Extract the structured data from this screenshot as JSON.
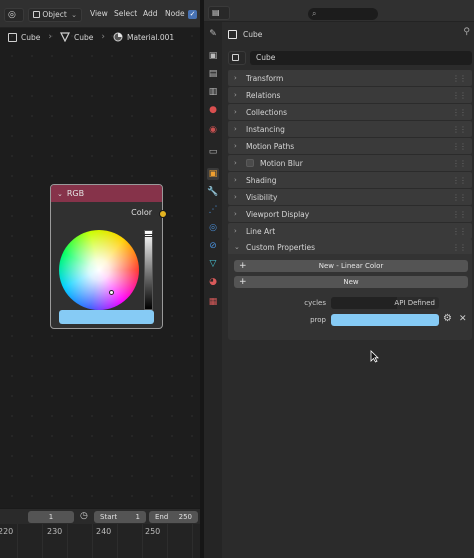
{
  "node_editor": {
    "header": {
      "mode": "Object",
      "menus": [
        "View",
        "Select",
        "Add",
        "Node"
      ]
    },
    "breadcrumb": [
      {
        "icon": "cube-icon",
        "label": "Cube"
      },
      {
        "icon": "mesh-data-icon",
        "label": "Cube"
      },
      {
        "icon": "material-icon",
        "label": "Material.001"
      }
    ],
    "node": {
      "title": "RGB",
      "output_label": "Color",
      "color": "#86cbf5",
      "header_color": "#86334a",
      "socket_color": "#e3b321"
    },
    "timeline": {
      "start_label": "Start",
      "start_value": "1",
      "end_label": "End",
      "end_value": "250",
      "current_frame": "1",
      "ruler_ticks": [
        "220",
        "230",
        "240",
        "250"
      ]
    }
  },
  "properties": {
    "object_name": "Cube",
    "object_field_value": "Cube",
    "panels": [
      {
        "label": "Transform",
        "expanded": false,
        "checkbox": false
      },
      {
        "label": "Relations",
        "expanded": false,
        "checkbox": false
      },
      {
        "label": "Collections",
        "expanded": false,
        "checkbox": false
      },
      {
        "label": "Instancing",
        "expanded": false,
        "checkbox": false
      },
      {
        "label": "Motion Paths",
        "expanded": false,
        "checkbox": false
      },
      {
        "label": "Motion Blur",
        "expanded": false,
        "checkbox": true
      },
      {
        "label": "Shading",
        "expanded": false,
        "checkbox": false
      },
      {
        "label": "Visibility",
        "expanded": false,
        "checkbox": false
      },
      {
        "label": "Viewport Display",
        "expanded": false,
        "checkbox": false
      },
      {
        "label": "Line Art",
        "expanded": false,
        "checkbox": false
      },
      {
        "label": "Custom Properties",
        "expanded": true,
        "checkbox": false
      }
    ],
    "custom_properties": {
      "new_linear_color_label": "New - Linear Color",
      "new_label": "New",
      "rows": [
        {
          "name": "cycles",
          "value": "API Defined"
        },
        {
          "name": "prop",
          "value": "",
          "color": "#86cbf5"
        }
      ]
    }
  }
}
